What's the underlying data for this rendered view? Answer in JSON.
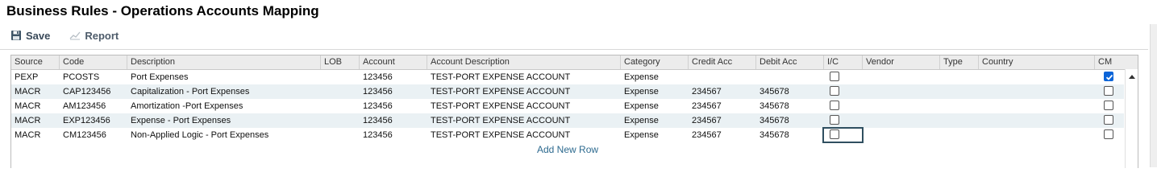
{
  "page": {
    "title": "Business Rules - Operations Accounts Mapping"
  },
  "toolbar": {
    "save_label": "Save",
    "save_icon": "floppy-disk-icon",
    "report_label": "Report",
    "report_icon": "line-chart-icon"
  },
  "grid": {
    "columns": {
      "source": "Source",
      "code": "Code",
      "description": "Description",
      "lob": "LOB",
      "account": "Account",
      "account_description": "Account Description",
      "category": "Category",
      "credit_acc": "Credit Acc",
      "debit_acc": "Debit Acc",
      "ic": "I/C",
      "vendor": "Vendor",
      "type": "Type",
      "country": "Country",
      "cm": "CM"
    },
    "rows": [
      {
        "source": "PEXP",
        "code": "PCOSTS",
        "description": "Port Expenses",
        "lob": "",
        "account": "123456",
        "account_description": "TEST-PORT EXPENSE ACCOUNT",
        "category": "Expense",
        "credit_acc": "",
        "debit_acc": "",
        "ic": false,
        "vendor": "",
        "type": "",
        "country": "",
        "cm": true
      },
      {
        "source": "MACR",
        "code": "CAP123456",
        "description": "Capitalization - Port Expenses",
        "lob": "",
        "account": "123456",
        "account_description": "TEST-PORT EXPENSE ACCOUNT",
        "category": "Expense",
        "credit_acc": "234567",
        "debit_acc": "345678",
        "ic": false,
        "vendor": "",
        "type": "",
        "country": "",
        "cm": false
      },
      {
        "source": "MACR",
        "code": "AM123456",
        "description": "Amortization -Port Expenses",
        "lob": "",
        "account": "123456",
        "account_description": "TEST-PORT EXPENSE ACCOUNT",
        "category": "Expense",
        "credit_acc": "234567",
        "debit_acc": "345678",
        "ic": false,
        "vendor": "",
        "type": "",
        "country": "",
        "cm": false
      },
      {
        "source": "MACR",
        "code": "EXP123456",
        "description": "Expense - Port Expenses",
        "lob": "",
        "account": "123456",
        "account_description": "TEST-PORT EXPENSE ACCOUNT",
        "category": "Expense",
        "credit_acc": "234567",
        "debit_acc": "345678",
        "ic": false,
        "vendor": "",
        "type": "",
        "country": "",
        "cm": false
      },
      {
        "source": "MACR",
        "code": "CM123456",
        "description": "Non-Applied Logic - Port Expenses",
        "lob": "",
        "account": "123456",
        "account_description": "TEST-PORT EXPENSE ACCOUNT",
        "category": "Expense",
        "credit_acc": "234567",
        "debit_acc": "345678",
        "ic": false,
        "vendor": "",
        "type": "",
        "country": "",
        "cm": false
      }
    ],
    "add_row_label": "Add New Row",
    "colors": {
      "alt_row": "#eaf1f4",
      "header": "#ececec",
      "link": "#2d6a8f",
      "checked": "#0b64d8"
    }
  }
}
